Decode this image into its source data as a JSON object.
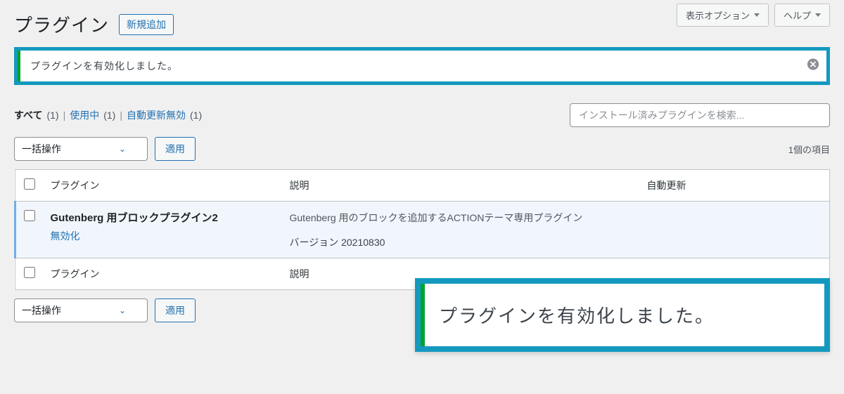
{
  "top": {
    "screen_options": "表示オプション",
    "help": "ヘルプ"
  },
  "header": {
    "title": "プラグイン",
    "add_new": "新規追加"
  },
  "notice": {
    "text": "プラグインを有効化しました。"
  },
  "filters": {
    "all_label": "すべて",
    "all_count": "(1)",
    "active_label": "使用中",
    "active_count": "(1)",
    "auto_off_label": "自動更新無効",
    "auto_off_count": "(1)",
    "sep": "|"
  },
  "search": {
    "placeholder": "インストール済みプラグインを検索..."
  },
  "bulk": {
    "select_label": "一括操作",
    "apply": "適用",
    "items": "1個の項目"
  },
  "columns": {
    "plugin": "プラグイン",
    "description": "説明",
    "auto_update": "自動更新"
  },
  "rows": [
    {
      "name": "Gutenberg 用ブロックプラグイン2",
      "deactivate": "無効化",
      "description": "Gutenberg 用のブロックを追加するACTIONテーマ専用プラグイン",
      "version": "バージョン 20210830"
    }
  ],
  "callout": {
    "text": "プラグインを有効化しました。"
  }
}
